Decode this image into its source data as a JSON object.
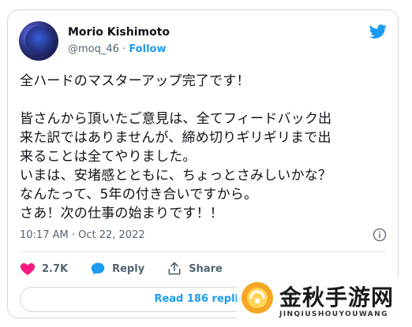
{
  "user": {
    "name": "Morio Kishimoto",
    "handle": "@moq_46",
    "separator": " · ",
    "follow_label": "Follow"
  },
  "tweet": {
    "text": "全ハードのマスターアップ完了です！\n\n皆さんから頂いたご意見は、全てフィードバック出\n来た訳ではありませんが、締め切りギリギリまで出\n来ることは全てやりました。\nいまは、安堵感とともに、ちょっとさみしいかな？\nなんたって、5年の付き合いですから。\nさあ！次の仕事の始まりです！！",
    "time": "10:17 AM",
    "date_separator": " · ",
    "date": "Oct 22, 2022"
  },
  "actions": {
    "likes": "2.7K",
    "reply_label": "Reply",
    "share_label": "Share"
  },
  "read_replies_label": "Read 186 replies",
  "watermark": {
    "title": "金秋手游网",
    "subtitle": "JINQIUSHOUYOUWANG"
  },
  "colors": {
    "accent": "#1d9bf0",
    "like": "#f91880",
    "muted": "#536471",
    "watermark_orange": "#f5a623"
  },
  "icons": [
    "twitter-bird-icon",
    "info-icon",
    "heart-icon",
    "reply-icon",
    "share-icon"
  ]
}
